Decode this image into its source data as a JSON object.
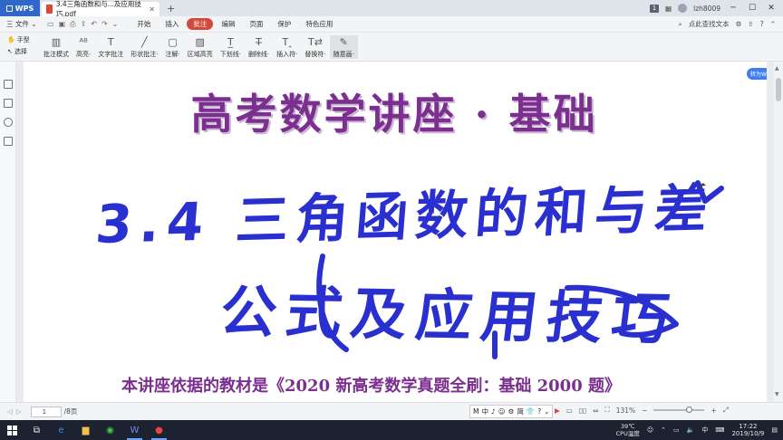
{
  "titlebar": {
    "app_name": "WPS",
    "doc_tab": "3.4三角函数和与...及应用技巧.pdf",
    "badge": "1",
    "user": "lzh8009",
    "minimize": "─",
    "maximize": "☐",
    "close": "✕"
  },
  "menubar": {
    "file": "三 文件 ⌄",
    "tabs": [
      "开始",
      "插入",
      "批注",
      "编辑",
      "页面",
      "保护",
      "特色应用"
    ],
    "active_tab": "批注",
    "search": "点此查找文本",
    "accent": "#d4483b"
  },
  "toolbar": {
    "hand": "手型",
    "select": "选择",
    "tools": [
      {
        "label": "批注模式",
        "icon": "annotation-mode-icon"
      },
      {
        "label": "高亮·",
        "icon": "highlight-icon"
      },
      {
        "label": "文字批注",
        "icon": "text-note-icon"
      },
      {
        "label": "形状批注·",
        "icon": "shape-icon"
      },
      {
        "label": "注解·",
        "icon": "comment-icon"
      },
      {
        "label": "区域高亮",
        "icon": "area-highlight-icon"
      },
      {
        "label": "下划线·",
        "icon": "underline-icon"
      },
      {
        "label": "删除线·",
        "icon": "strikethrough-icon"
      },
      {
        "label": "插入符·",
        "icon": "insert-caret-icon"
      },
      {
        "label": "替换符·",
        "icon": "replace-icon"
      },
      {
        "label": "随意画·",
        "icon": "freehand-icon"
      }
    ]
  },
  "document": {
    "title": "高考数学讲座 · 基础",
    "handwriting_line1": "3.4 三角函数的和与差",
    "handwriting_line2": "公式及应用技巧",
    "footer": "本讲座依据的教材是《2020 新高考数学真题全刷：基础 2000 题》",
    "to_word": "转为Word",
    "title_color": "#7b2f8e",
    "ink_color": "#2a2fd0"
  },
  "statusbar": {
    "page": "1",
    "total": "/8页",
    "zoom": "131%",
    "ime": [
      "M",
      "中",
      "♪",
      "☺",
      "⚙",
      "简",
      "👕",
      "?",
      "⌄"
    ]
  },
  "taskbar": {
    "temperature": "39℃",
    "cpu": "CPU温度",
    "ime": "中",
    "time": "17:22",
    "date": "2019/10/9"
  }
}
